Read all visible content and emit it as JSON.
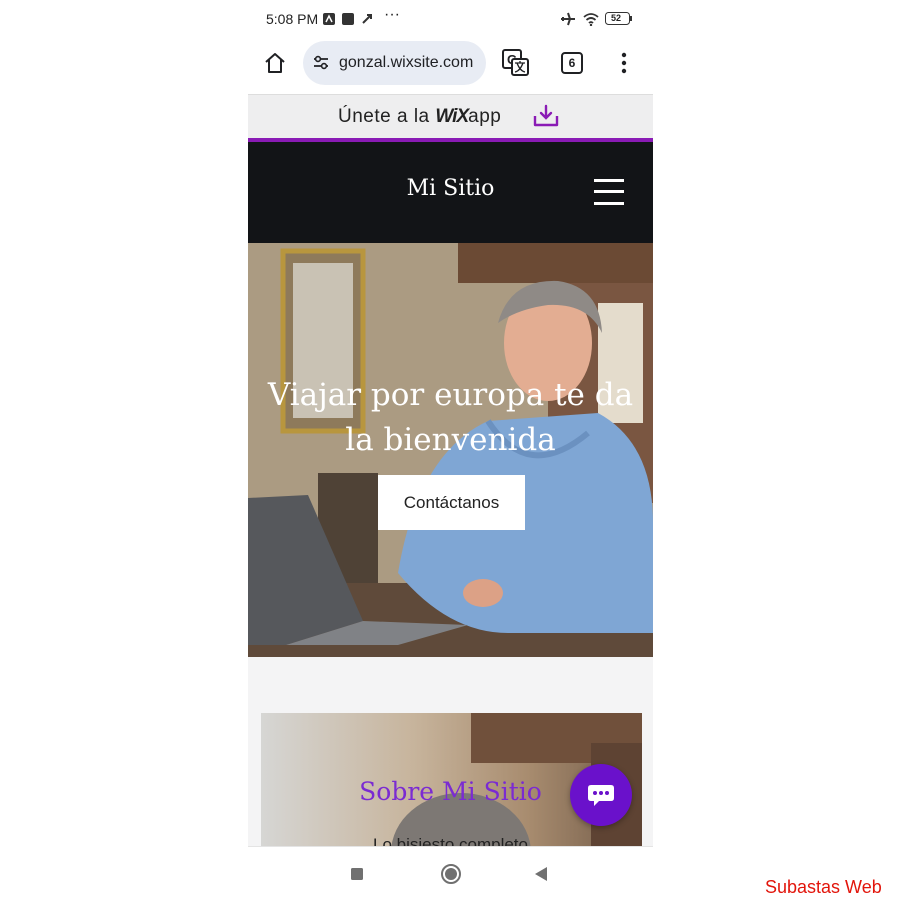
{
  "status_bar": {
    "time": "5:08 PM",
    "battery": "52",
    "icons": [
      "notification-icon",
      "app-icon",
      "rocket-icon",
      "more-dots-icon",
      "airplane-icon",
      "wifi-icon",
      "battery-icon"
    ]
  },
  "browser": {
    "url": "gonzal.wixsite.com",
    "tab_count": "6",
    "icons": [
      "home-icon",
      "site-settings-icon",
      "translate-icon",
      "tab-switcher-icon",
      "overflow-menu-icon"
    ]
  },
  "wix_banner": {
    "prefix": "Únete a la",
    "logo": "WiX",
    "suffix": "app"
  },
  "site": {
    "title": "Mi Sitio",
    "hero_title": "Viajar por europa te da la bienvenida",
    "cta_label": "Contáctanos",
    "about_title": "Sobre Mi Sitio",
    "about_body": "Lo bisiesto completo"
  },
  "colors": {
    "wix_accent": "#8a1bb5",
    "header_bg": "#121417",
    "chat_button": "#6a11cb",
    "about_title": "#7b2bd2",
    "watermark": "#e2150b"
  },
  "watermark": "Subastas Web"
}
